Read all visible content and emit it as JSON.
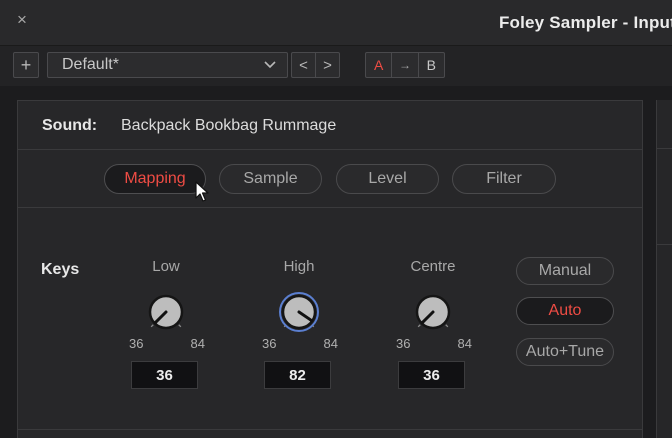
{
  "window": {
    "title": "Foley Sampler - Input",
    "close_glyph": "×"
  },
  "toolbar": {
    "add_glyph": "+",
    "preset_value": "Default*",
    "prev_glyph": "<",
    "next_glyph": ">",
    "a_label": "A",
    "copy_glyph": "→",
    "b_label": "B"
  },
  "sound": {
    "label": "Sound:",
    "value": "Backpack Bookbag Rummage"
  },
  "tabs": [
    {
      "label": "Mapping",
      "active": true
    },
    {
      "label": "Sample"
    },
    {
      "label": "Level"
    },
    {
      "label": "Filter"
    }
  ],
  "keys": {
    "label": "Keys",
    "knobs": [
      {
        "title": "Low",
        "min": "36",
        "max": "84",
        "value": "36",
        "fraction": 0.0
      },
      {
        "title": "High",
        "min": "36",
        "max": "84",
        "value": "82",
        "fraction": 0.96
      },
      {
        "title": "Centre",
        "min": "36",
        "max": "84",
        "value": "36",
        "fraction": 0.0
      }
    ]
  },
  "modes": [
    {
      "label": "Manual"
    },
    {
      "label": "Auto",
      "selected": true
    },
    {
      "label": "Auto+Tune"
    }
  ],
  "colors": {
    "accent": "#ee4c44",
    "focus_ring": "#5b7fd0",
    "background": "#1c1c1e"
  },
  "icons": [
    "close-icon",
    "add-icon",
    "chevron-down-icon",
    "prev-icon",
    "next-icon",
    "copy-arrow-icon",
    "mouse-pointer-icon"
  ]
}
